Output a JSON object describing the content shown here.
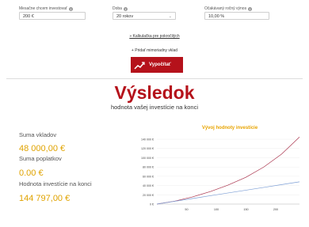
{
  "form": {
    "deposit": {
      "label": "Mesačne chcem investovať",
      "value": "200 €"
    },
    "duration": {
      "label": "Doba",
      "value": "20 rokov"
    },
    "yield": {
      "label": "Očakávaný ročný výnos",
      "value": "10,00 %"
    }
  },
  "links": {
    "advanced": "» Kalkulačka pre pokročilých",
    "add_deposit": "+ Pridať mimoriadny vklad"
  },
  "button": {
    "label": "Vypočítať"
  },
  "result": {
    "title": "Výsledok",
    "subtitle": "hodnota vašej investície na konci"
  },
  "summary": [
    {
      "label": "Suma vkladov",
      "value": "48 000,00 €"
    },
    {
      "label": "Suma poplatkov",
      "value": "0.00 €"
    },
    {
      "label": "Hodnota investície na konci",
      "value": "144 797,00 €"
    }
  ],
  "chart_data": {
    "type": "line",
    "title": "Vývoj hodnoty investície",
    "xlim": [
      0,
      240
    ],
    "ylim": [
      0,
      140000
    ],
    "x_ticks": [
      50,
      100,
      150,
      200
    ],
    "y_ticks": [
      0,
      20000,
      40000,
      60000,
      80000,
      100000,
      120000,
      140000
    ],
    "y_tick_labels": [
      "0 €",
      "20 000 €",
      "40 000 €",
      "60 000 €",
      "80 000 €",
      "100 000 €",
      "120 000 €",
      "140 000 €"
    ],
    "series": [
      {
        "color": "#a9314b",
        "x": [
          0,
          30,
          60,
          90,
          120,
          150,
          180,
          210,
          240
        ],
        "values": [
          0,
          6300,
          15500,
          27000,
          41000,
          58000,
          80000,
          108000,
          144797
        ]
      },
      {
        "color": "#7d9fd6",
        "x": [
          0,
          30,
          60,
          90,
          120,
          150,
          180,
          210,
          240
        ],
        "values": [
          0,
          6000,
          12000,
          18000,
          24000,
          30000,
          36000,
          42000,
          48000
        ]
      }
    ]
  }
}
